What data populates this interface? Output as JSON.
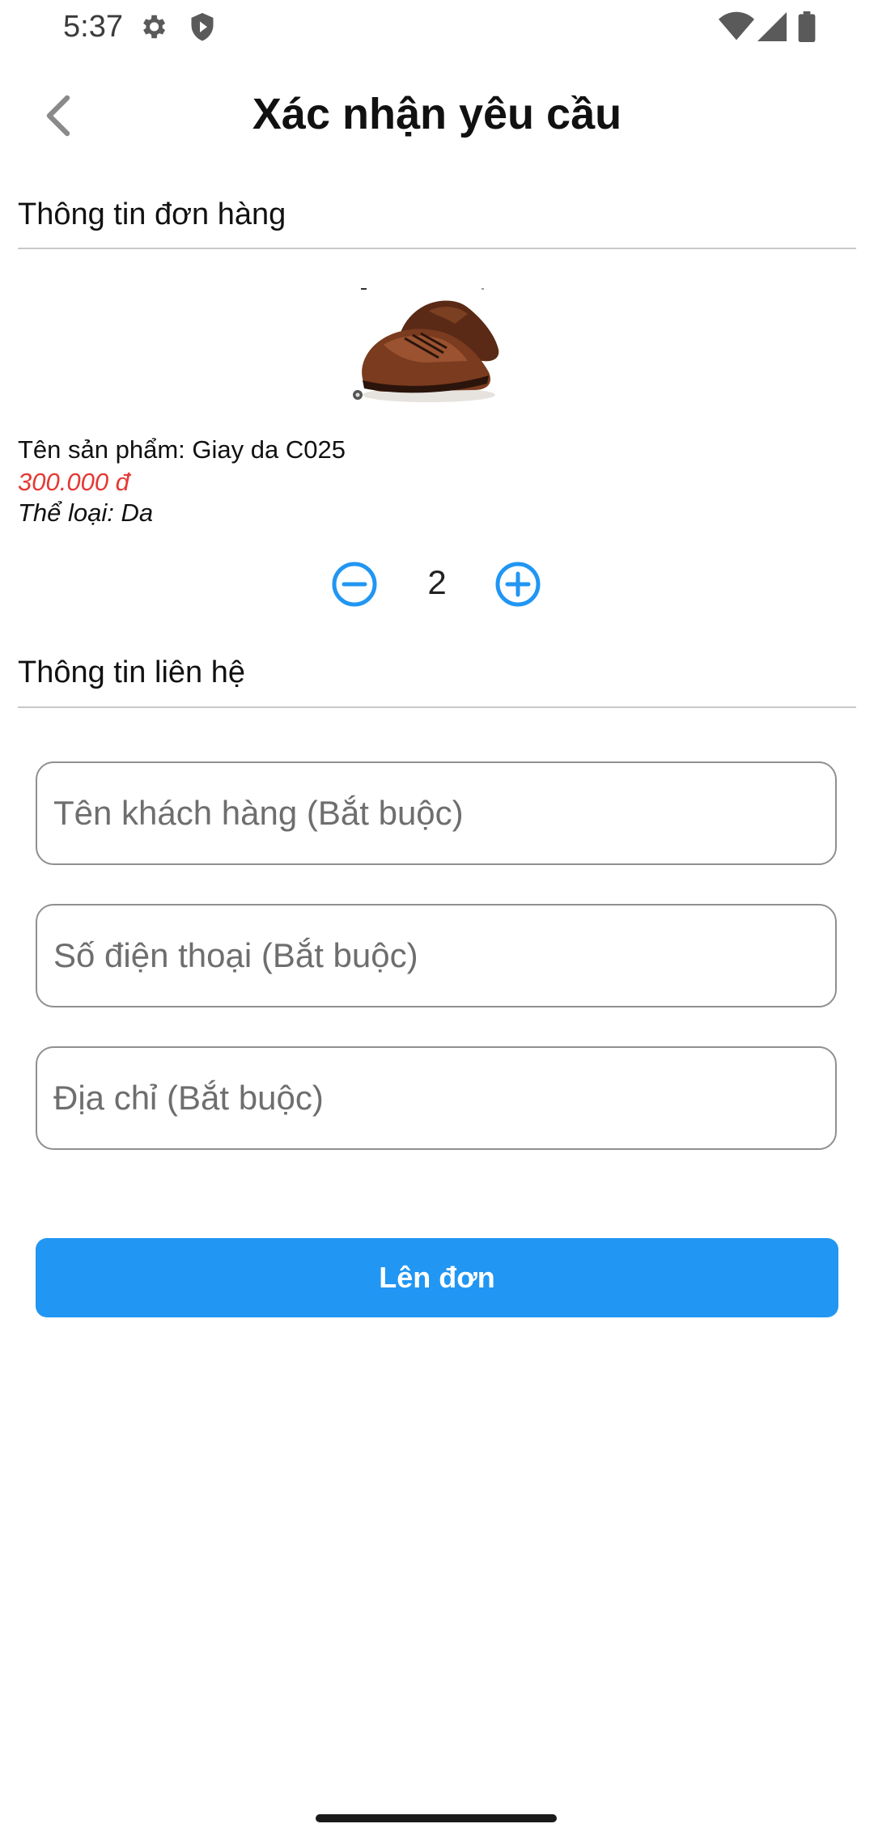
{
  "status_bar": {
    "time": "5:37",
    "icons": [
      "gear-icon",
      "shield-icon",
      "wifi-icon",
      "signal-icon",
      "battery-icon"
    ]
  },
  "header": {
    "title": "Xác nhận yêu cầu",
    "back_icon": "chevron-left-icon"
  },
  "order_section": {
    "title": "Thông tin đơn hàng",
    "product": {
      "name": "Tên sản phẩm: Giay da C025",
      "price": "300.000 đ",
      "category": "Thể loại: Da",
      "image": "brown-leather-shoes"
    },
    "quantity": {
      "value": "2",
      "minus_icon": "minus-circle-icon",
      "plus_icon": "plus-circle-icon"
    }
  },
  "contact_section": {
    "title": "Thông tin liên hệ",
    "fields": [
      {
        "placeholder": "Tên khách hàng (Bắt buộc)",
        "value": ""
      },
      {
        "placeholder": "Số điện thoại (Bắt buộc)",
        "value": ""
      },
      {
        "placeholder": "Địa chỉ (Bắt buộc)",
        "value": ""
      }
    ]
  },
  "submit": {
    "label": "Lên đơn"
  },
  "colors": {
    "accent": "#2196f3",
    "price": "#e53935",
    "divider": "#c9c9c9",
    "field_border": "#8f8f8f"
  }
}
